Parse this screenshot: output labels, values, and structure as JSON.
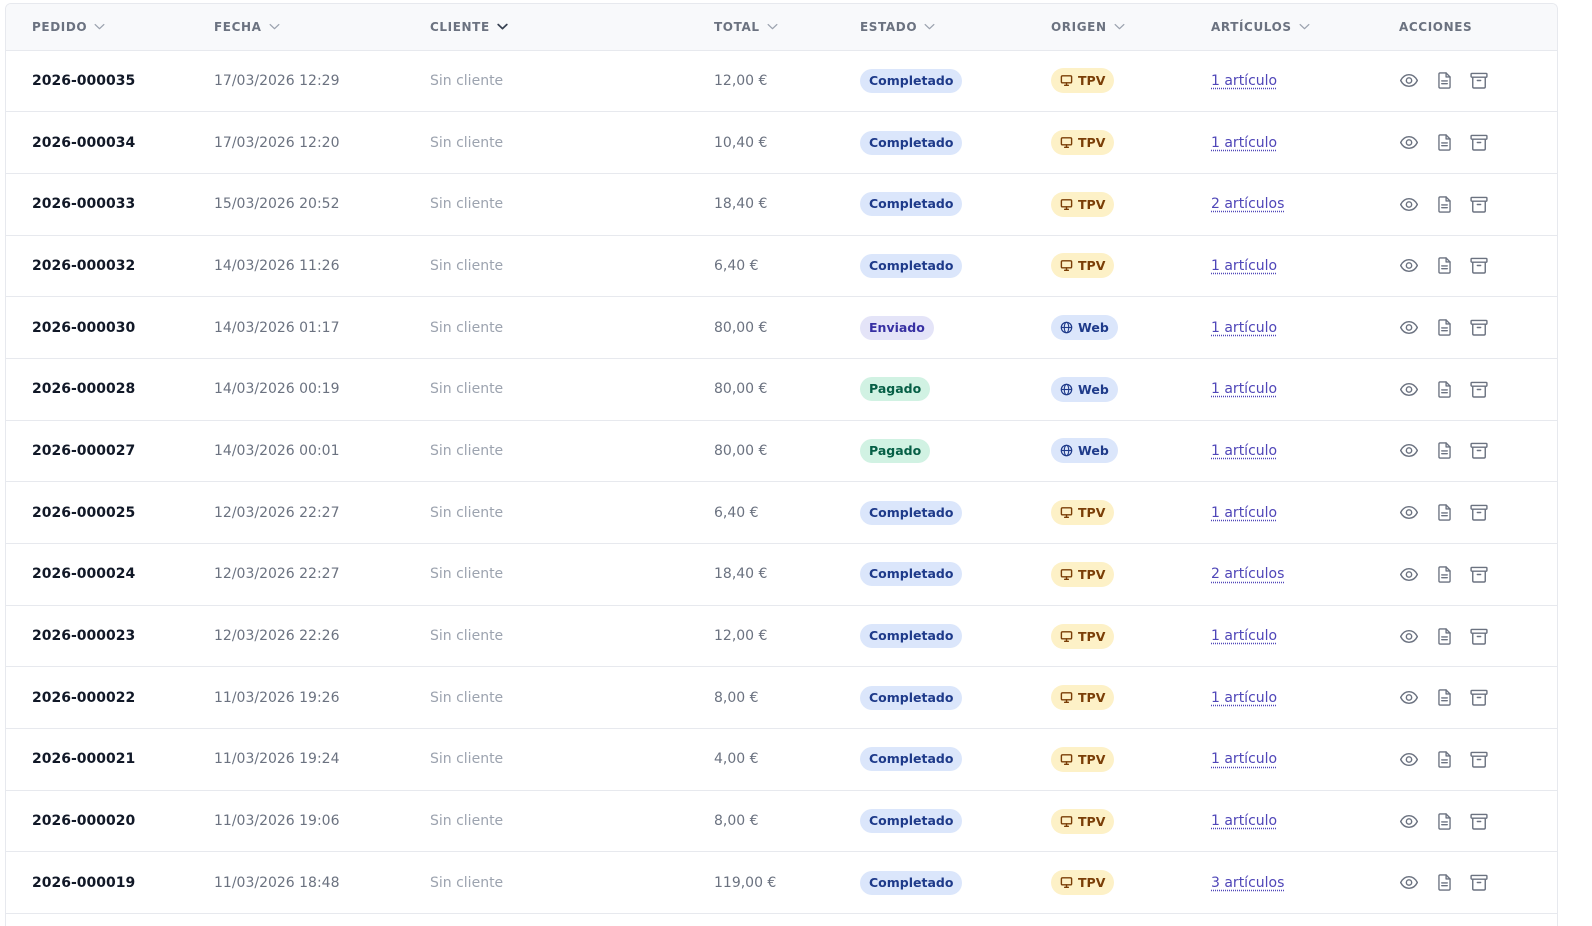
{
  "columns": [
    {
      "label": "PEDIDO",
      "sortable": true
    },
    {
      "label": "FECHA",
      "sortable": true
    },
    {
      "label": "CLIENTE",
      "sortable": true
    },
    {
      "label": "TOTAL",
      "sortable": true
    },
    {
      "label": "ESTADO",
      "sortable": true
    },
    {
      "label": "ORIGEN",
      "sortable": true
    },
    {
      "label": "ARTÍCULOS",
      "sortable": true
    },
    {
      "label": "ACCIONES",
      "sortable": false
    }
  ],
  "colors": {
    "completado_bg": "#dbe6fb",
    "enviado_bg": "#e4e4f8",
    "pagado_bg": "#d1f2e3",
    "tpv_bg": "#fdf1c7",
    "web_bg": "#dbe6fb",
    "link": "#4f46b8"
  },
  "rows": [
    {
      "id": "2026-000035",
      "date": "17/03/2026 12:29",
      "client": "Sin cliente",
      "total": "12,00 €",
      "status": "Completado",
      "status_key": "completado",
      "origin": "TPV",
      "origin_icon": "monitor-icon",
      "items": "1 artículo"
    },
    {
      "id": "2026-000034",
      "date": "17/03/2026 12:20",
      "client": "Sin cliente",
      "total": "10,40 €",
      "status": "Completado",
      "status_key": "completado",
      "origin": "TPV",
      "origin_icon": "monitor-icon",
      "items": "1 artículo"
    },
    {
      "id": "2026-000033",
      "date": "15/03/2026 20:52",
      "client": "Sin cliente",
      "total": "18,40 €",
      "status": "Completado",
      "status_key": "completado",
      "origin": "TPV",
      "origin_icon": "monitor-icon",
      "items": "2 artículos"
    },
    {
      "id": "2026-000032",
      "date": "14/03/2026 11:26",
      "client": "Sin cliente",
      "total": "6,40 €",
      "status": "Completado",
      "status_key": "completado",
      "origin": "TPV",
      "origin_icon": "monitor-icon",
      "items": "1 artículo"
    },
    {
      "id": "2026-000030",
      "date": "14/03/2026 01:17",
      "client": "Sin cliente",
      "total": "80,00 €",
      "status": "Enviado",
      "status_key": "enviado",
      "origin": "Web",
      "origin_icon": "globe-icon",
      "items": "1 artículo"
    },
    {
      "id": "2026-000028",
      "date": "14/03/2026 00:19",
      "client": "Sin cliente",
      "total": "80,00 €",
      "status": "Pagado",
      "status_key": "pagado",
      "origin": "Web",
      "origin_icon": "globe-icon",
      "items": "1 artículo"
    },
    {
      "id": "2026-000027",
      "date": "14/03/2026 00:01",
      "client": "Sin cliente",
      "total": "80,00 €",
      "status": "Pagado",
      "status_key": "pagado",
      "origin": "Web",
      "origin_icon": "globe-icon",
      "items": "1 artículo"
    },
    {
      "id": "2026-000025",
      "date": "12/03/2026 22:27",
      "client": "Sin cliente",
      "total": "6,40 €",
      "status": "Completado",
      "status_key": "completado",
      "origin": "TPV",
      "origin_icon": "monitor-icon",
      "items": "1 artículo"
    },
    {
      "id": "2026-000024",
      "date": "12/03/2026 22:27",
      "client": "Sin cliente",
      "total": "18,40 €",
      "status": "Completado",
      "status_key": "completado",
      "origin": "TPV",
      "origin_icon": "monitor-icon",
      "items": "2 artículos"
    },
    {
      "id": "2026-000023",
      "date": "12/03/2026 22:26",
      "client": "Sin cliente",
      "total": "12,00 €",
      "status": "Completado",
      "status_key": "completado",
      "origin": "TPV",
      "origin_icon": "monitor-icon",
      "items": "1 artículo"
    },
    {
      "id": "2026-000022",
      "date": "11/03/2026 19:26",
      "client": "Sin cliente",
      "total": "8,00 €",
      "status": "Completado",
      "status_key": "completado",
      "origin": "TPV",
      "origin_icon": "monitor-icon",
      "items": "1 artículo"
    },
    {
      "id": "2026-000021",
      "date": "11/03/2026 19:24",
      "client": "Sin cliente",
      "total": "4,00 €",
      "status": "Completado",
      "status_key": "completado",
      "origin": "TPV",
      "origin_icon": "monitor-icon",
      "items": "1 artículo"
    },
    {
      "id": "2026-000020",
      "date": "11/03/2026 19:06",
      "client": "Sin cliente",
      "total": "8,00 €",
      "status": "Completado",
      "status_key": "completado",
      "origin": "TPV",
      "origin_icon": "monitor-icon",
      "items": "1 artículo"
    },
    {
      "id": "2026-000019",
      "date": "11/03/2026 18:48",
      "client": "Sin cliente",
      "total": "119,00 €",
      "status": "Completado",
      "status_key": "completado",
      "origin": "TPV",
      "origin_icon": "monitor-icon",
      "items": "3 artículos"
    }
  ],
  "row_actions": [
    {
      "name": "view-icon",
      "label": "Ver"
    },
    {
      "name": "document-icon",
      "label": "Factura"
    },
    {
      "name": "archive-icon",
      "label": "Archivar"
    }
  ]
}
